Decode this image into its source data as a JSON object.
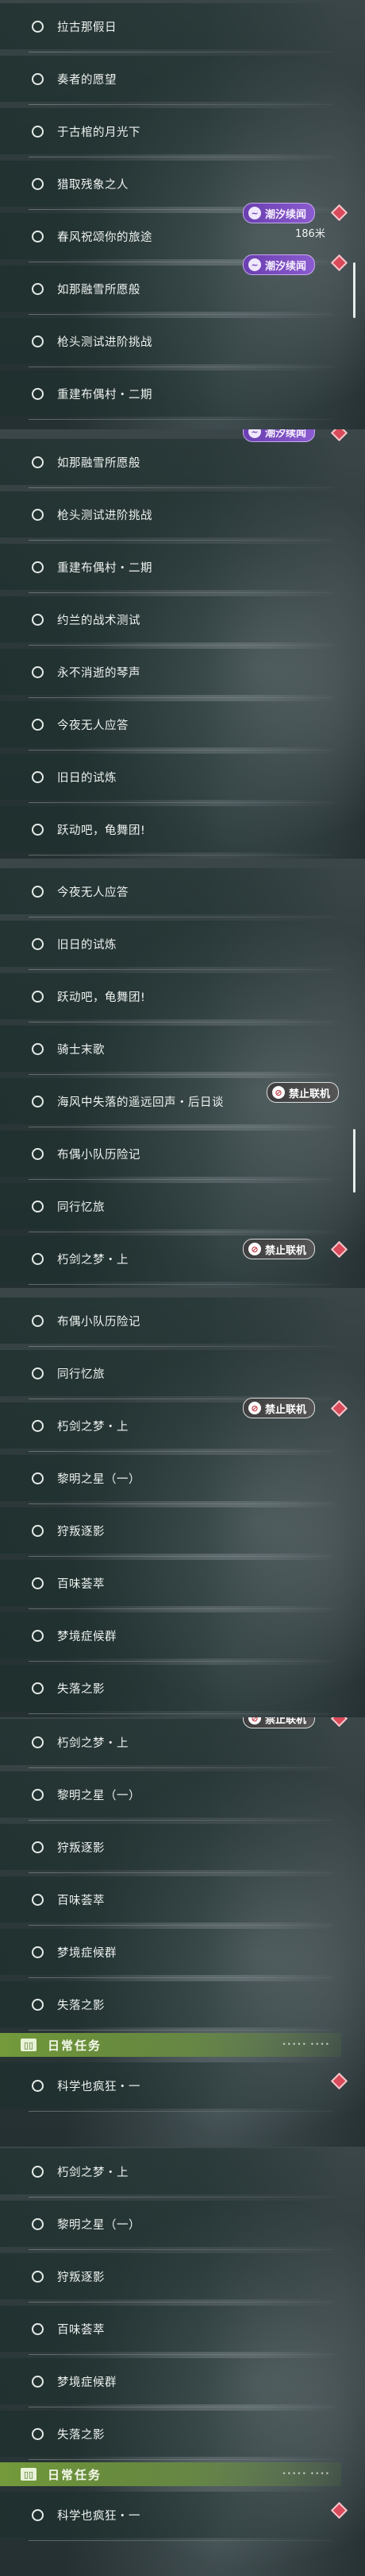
{
  "tags": {
    "tide": "潮汐续闻",
    "no_coop": "禁止联机"
  },
  "section": {
    "daily_title": "日常任务",
    "daily_dots": "••••• ••••"
  },
  "panel1": {
    "items": [
      "拉古那假日",
      "奏者的愿望",
      "于古棺的月光下",
      "猎取残象之人",
      "春风祝颂你的旅途",
      "如那融雪所愿般",
      "枪头测试进阶挑战",
      "重建布偶村・二期"
    ],
    "distance": "186米"
  },
  "panel2": {
    "items": [
      "如那融雪所愿般",
      "枪头测试进阶挑战",
      "重建布偶村・二期",
      "约兰的战术测试",
      "永不消逝的琴声",
      "今夜无人应答",
      "旧日的试炼",
      "跃动吧，龟舞团!"
    ]
  },
  "panel3": {
    "items": [
      "今夜无人应答",
      "旧日的试炼",
      "跃动吧，龟舞团!",
      "骑士末歌",
      "海风中失落的遥远回声・后日谈",
      "布偶小队历险记",
      "同行忆旅",
      "朽剑之梦・上"
    ]
  },
  "panel4": {
    "items": [
      "布偶小队历险记",
      "同行忆旅",
      "朽剑之梦・上",
      "黎明之星（一）",
      "狩叛逐影",
      "百味荟萃",
      "梦境症候群",
      "失落之影"
    ]
  },
  "panel5": {
    "items": [
      "朽剑之梦・上",
      "黎明之星（一）",
      "狩叛逐影",
      "百味荟萃",
      "梦境症候群",
      "失落之影"
    ],
    "daily_item": "科学也疯狂・一"
  },
  "panel6": {
    "items": [
      "朽剑之梦・上",
      "黎明之星（一）",
      "狩叛逐影",
      "百味荟萃",
      "梦境症候群",
      "失落之影"
    ],
    "daily_item": "科学也疯狂・一"
  },
  "colors": {
    "tide_tag": "#7a4cc2",
    "ban_tag": "#4a4a4a",
    "section_green": "#78a03c",
    "diamond": "#d94a5a"
  }
}
